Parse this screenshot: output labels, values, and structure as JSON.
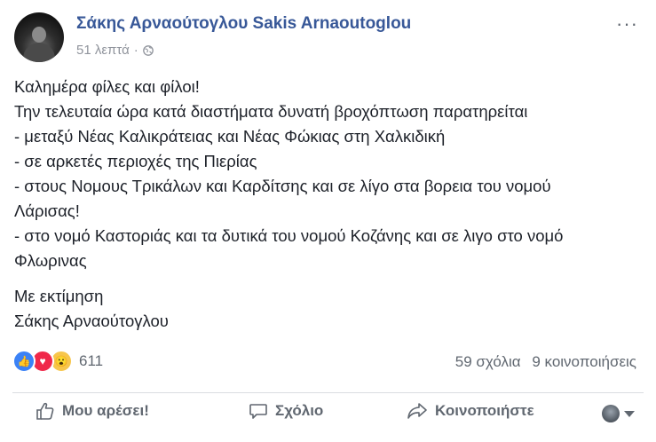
{
  "post": {
    "author": "Σάκης Αρναούτογλου Sakis Arnaoutoglou",
    "timestamp": "51 λεπτά",
    "separator": "·",
    "privacy_icon": "globe-icon",
    "more_label": "···",
    "lines": [
      "Καλημέρα φίλες και φίλοι!",
      "Την τελευταία ώρα κατά διαστήματα δυνατή βροχόπτωση παρατηρείται",
      "- μεταξύ Νέας Καλικράτειας και Νέας Φώκιας στη Χαλκιδική",
      "- σε αρκετές περιοχές της Πιερίας",
      "- στους Νομους Τρικάλων και Καρδίτσης και σε λίγο στα βορεια του νομού",
      "Λάρισας!",
      "- στο νομό Καστοριάς και τα δυτικά του νομού Κοζάνης και σε λιγο στο νομό",
      "Φλωρινας"
    ],
    "signoff": [
      "Με εκτίμηση",
      "Σάκης Αρναούτογλου"
    ]
  },
  "reactions": {
    "icons": [
      "like-reaction-icon",
      "love-reaction-icon",
      "wow-reaction-icon"
    ],
    "like_glyph": "👍",
    "love_glyph": "♥",
    "wow_glyph": "😮",
    "count": "611"
  },
  "stats": {
    "comments": "59 σχόλια",
    "shares": "9 κοινοποιήσεις"
  },
  "actions": {
    "like": "Μου αρέσει!",
    "comment": "Σχόλιο",
    "share": "Κοινοποιήστε"
  },
  "colors": {
    "author": "#385898",
    "text": "#1d2129",
    "muted": "#606770",
    "like": "#3b82f6",
    "love": "#f0284a",
    "wow": "#f7c64c"
  }
}
